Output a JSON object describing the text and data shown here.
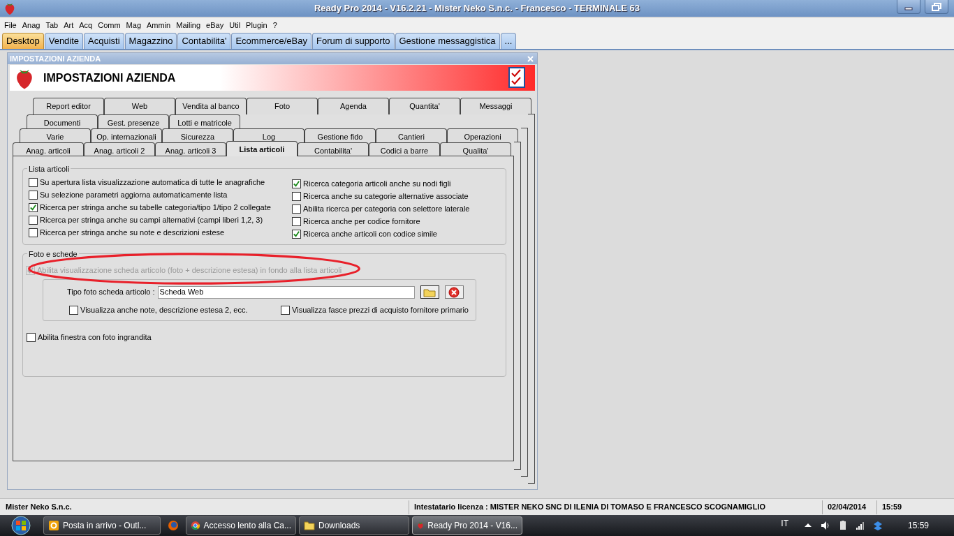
{
  "window": {
    "title": "Ready Pro 2014 - V16.2.21 - Mister Neko S.n.c. - Francesco - TERMINALE 63"
  },
  "menu": [
    "File",
    "Anag",
    "Tab",
    "Art",
    "Acq",
    "Comm",
    "Mag",
    "Ammin",
    "Mailing",
    "eBay",
    "Util",
    "Plugin",
    "?"
  ],
  "main_tabs": [
    {
      "label": "Desktop",
      "selected": true
    },
    {
      "label": "Vendite",
      "selected": false
    },
    {
      "label": "Acquisti",
      "selected": false
    },
    {
      "label": "Magazzino",
      "selected": false
    },
    {
      "label": "Contabilita'",
      "selected": false
    },
    {
      "label": "Ecommerce/eBay",
      "selected": false
    },
    {
      "label": "Forum di supporto",
      "selected": false
    },
    {
      "label": "Gestione messaggistica",
      "selected": false
    },
    {
      "label": "...",
      "selected": false
    }
  ],
  "dialog": {
    "title": "IMPOSTAZIONI AZIENDA",
    "header": "IMPOSTAZIONI AZIENDA",
    "tab_rows": [
      {
        "tabs": [
          {
            "label": "Report editor",
            "selected": false
          },
          {
            "label": "Web",
            "selected": false
          },
          {
            "label": "Vendita al banco",
            "selected": false
          },
          {
            "label": "Foto",
            "selected": false
          },
          {
            "label": "Agenda",
            "selected": false
          },
          {
            "label": "Quantita'",
            "selected": false
          },
          {
            "label": "Messaggi",
            "selected": false
          }
        ]
      },
      {
        "tabs": [
          {
            "label": "Documenti",
            "selected": false
          },
          {
            "label": "Gest. presenze",
            "selected": false
          },
          {
            "label": "Lotti e matricole",
            "selected": false
          }
        ]
      },
      {
        "tabs": [
          {
            "label": "Varie",
            "selected": false
          },
          {
            "label": "Op. internazionali",
            "selected": false
          },
          {
            "label": "Sicurezza",
            "selected": false
          },
          {
            "label": "Log",
            "selected": false
          },
          {
            "label": "Gestione fido",
            "selected": false
          },
          {
            "label": "Cantieri",
            "selected": false
          },
          {
            "label": "Operazioni",
            "selected": false
          }
        ]
      },
      {
        "tabs": [
          {
            "label": "Anag. articoli",
            "selected": false
          },
          {
            "label": "Anag. articoli 2",
            "selected": false
          },
          {
            "label": "Anag. articoli 3",
            "selected": false
          },
          {
            "label": "Lista articoli",
            "selected": true
          },
          {
            "label": "Contabilita'",
            "selected": false
          },
          {
            "label": "Codici a barre",
            "selected": false
          },
          {
            "label": "Qualita'",
            "selected": false
          }
        ]
      }
    ],
    "lista_articoli": {
      "legend": "Lista articoli",
      "left_options": [
        {
          "label": "Su apertura lista visualizzazione automatica di tutte le anagrafiche",
          "checked": false
        },
        {
          "label": "Su selezione parametri aggiorna automaticamente lista",
          "checked": false
        },
        {
          "label": "Ricerca per stringa anche su tabelle categoria/tipo 1/tipo 2 collegate",
          "checked": true
        },
        {
          "label": "Ricerca per stringa anche su campi alternativi (campi liberi 1,2, 3)",
          "checked": false
        },
        {
          "label": "Ricerca per stringa anche su note e descrizioni estese",
          "checked": false
        }
      ],
      "right_options": [
        {
          "label": "Ricerca categoria articoli anche su nodi figli",
          "checked": true
        },
        {
          "label": "Ricerca anche su categorie alternative associate",
          "checked": false
        },
        {
          "label": "Abilita ricerca per categoria con selettore laterale",
          "checked": false
        },
        {
          "label": "Ricerca anche per codice fornitore",
          "checked": false
        },
        {
          "label": "Ricerca anche articoli con codice simile",
          "checked": true
        }
      ]
    },
    "foto_e_schede": {
      "legend": "Foto e schede",
      "main_option": {
        "label": "Abilita visualizzazione scheda articolo (foto + descrizione estesa) in fondo alla lista articoli",
        "checked": true,
        "disabled": true
      },
      "tipo_foto": {
        "label": "Tipo foto scheda articolo :",
        "value": "Scheda Web"
      },
      "options": [
        {
          "label": "Visualizza anche note, descrizione estesa 2, ecc.",
          "checked": false
        },
        {
          "label": "Visualizza fasce prezzi di acquisto fornitore primario",
          "checked": false
        }
      ],
      "zoom_option": {
        "label": "Abilita finestra con foto ingrandita",
        "checked": false
      }
    }
  },
  "status_bar": {
    "company": "Mister Neko S.n.c.",
    "license": "Intestatario licenza : MISTER NEKO SNC DI ILENIA DI TOMASO E FRANCESCO SCOGNAMIGLIO",
    "date": "02/04/2014",
    "time": "15:59"
  },
  "taskbar": {
    "items": [
      {
        "kind": "outlook",
        "label": "Posta in arrivo - Outl...",
        "selected": false
      },
      {
        "kind": "firefox",
        "selected": false
      },
      {
        "kind": "chrome",
        "label": "Accesso lento alla Ca...",
        "selected": false
      },
      {
        "kind": "folder",
        "label": "Downloads",
        "selected": false
      },
      {
        "kind": "readypro",
        "label": "Ready Pro 2014 - V16...",
        "selected": true
      }
    ],
    "language": "IT",
    "clock": "15:59"
  }
}
